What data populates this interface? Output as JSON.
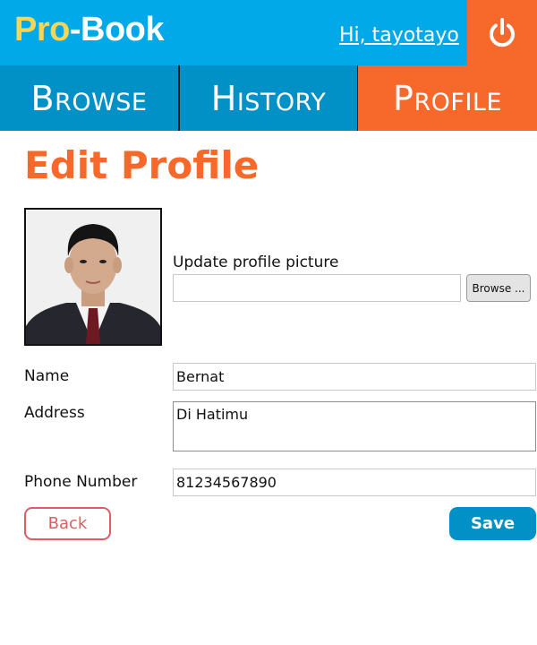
{
  "header": {
    "logo_part1": "Pro",
    "logo_part2": "-Book",
    "greeting": "Hi, tayotayo",
    "logout_icon": "power-icon"
  },
  "nav": {
    "items": [
      {
        "label": "Browse",
        "active": false
      },
      {
        "label": "History",
        "active": false
      },
      {
        "label": "Profile",
        "active": true
      }
    ]
  },
  "main": {
    "title": "Edit Profile",
    "avatar": "profile-photo",
    "upload_label": "Update profile picture",
    "browse_label": "Browse ...",
    "fields": {
      "name": {
        "label": "Name",
        "value": "Bernat"
      },
      "address": {
        "label": "Address",
        "value": "Di Hatimu"
      },
      "phone": {
        "label": "Phone Number",
        "value": "81234567890"
      }
    },
    "back_label": "Back",
    "save_label": "Save"
  },
  "colors": {
    "header_blue": "#01a9e8",
    "nav_blue": "#0191c6",
    "accent_orange": "#f6692b",
    "logo_yellow": "#fbd553",
    "back_red": "#dc5d63"
  }
}
